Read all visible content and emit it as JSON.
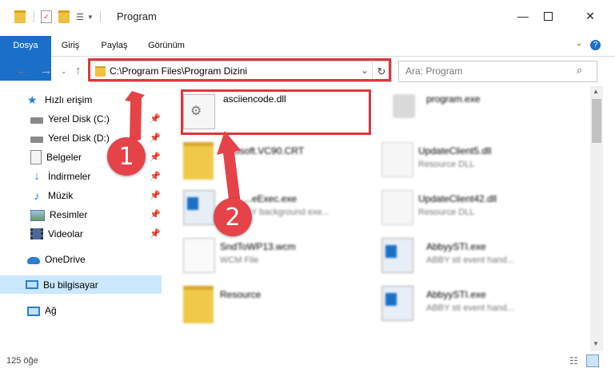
{
  "window": {
    "title": "Program",
    "minimize_icon": "minimize-icon",
    "maximize_icon": "maximize-icon",
    "close_icon": "close-icon"
  },
  "ribbon": {
    "tabs": [
      {
        "label": "Dosya",
        "active": true
      },
      {
        "label": "Giriş"
      },
      {
        "label": "Paylaş"
      },
      {
        "label": "Görünüm"
      }
    ]
  },
  "address": {
    "path": "C:\\Program Files\\Program Dizini"
  },
  "search": {
    "placeholder": "Ara: Program"
  },
  "nav_pane": {
    "items": [
      {
        "label": "Hızlı erişim",
        "icon": "star-icon"
      },
      {
        "label": "Yerel Disk (C:)",
        "icon": "drive-icon",
        "pinned": true
      },
      {
        "label": "Yerel Disk (D:)",
        "icon": "drive-icon",
        "pinned": true
      },
      {
        "label": "Belgeler",
        "icon": "documents-icon",
        "pinned": true
      },
      {
        "label": "İndirmeler",
        "icon": "download-icon",
        "pinned": true
      },
      {
        "label": "Müzik",
        "icon": "music-icon",
        "pinned": true
      },
      {
        "label": "Resimler",
        "icon": "pictures-icon",
        "pinned": true
      },
      {
        "label": "Videolar",
        "icon": "videos-icon",
        "pinned": true
      },
      {
        "label": "OneDrive",
        "icon": "cloud-icon"
      },
      {
        "label": "Bu bilgisayar",
        "icon": "computer-icon",
        "selected": true
      },
      {
        "label": "Ağ",
        "icon": "network-icon"
      }
    ]
  },
  "files": [
    {
      "name": "asciiencode.dll",
      "desc": "",
      "icon": "dll-gear-icon"
    },
    {
      "name": "program.exe",
      "desc": "",
      "icon": "exe-icon"
    },
    {
      "name": "...osoft.VC90.CRT",
      "desc": "",
      "icon": "folder-icon"
    },
    {
      "name": "UpdateClient5.dll",
      "desc": "Resource DLL",
      "icon": "dll-gear-icon"
    },
    {
      "name": "...eExec.exe",
      "desc": "...Y background exe...",
      "icon": "window-app-icon"
    },
    {
      "name": "UpdateClient42.dll",
      "desc": "Resource DLL",
      "icon": "dll-gear-icon"
    },
    {
      "name": "SndToWP13.wcm",
      "desc": "WCM File",
      "icon": "blank-file-icon"
    },
    {
      "name": "AbbyySTI.exe",
      "desc": "ABBY sti event hand...",
      "icon": "window-app-icon"
    },
    {
      "name": "Resource",
      "desc": "",
      "icon": "folder-icon"
    },
    {
      "name": "AbbyySTI.exe",
      "desc": "ABBY sti event hand...",
      "icon": "window-app-icon"
    }
  ],
  "status": {
    "count": "125 öğe"
  },
  "annotations": {
    "badge1": "1",
    "badge2": "2",
    "color": "#e0353a"
  }
}
